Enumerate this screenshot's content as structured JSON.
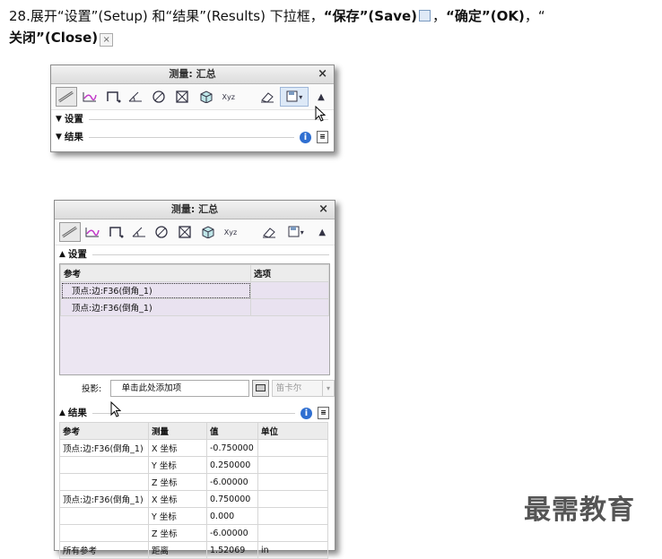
{
  "instruction": {
    "num": "28.",
    "p1": "展开“设置”(Setup) 和“结果”(Results) 下拉框，",
    "save": "“保存”(Save)",
    "sep1": "，",
    "ok": "“确定”(OK)",
    "sep2": "，“",
    "close": "关闭”(Close)",
    "close_glyph": "×"
  },
  "window": {
    "title": "测量: 汇总",
    "close_glyph": "×",
    "toolbar": {
      "icons": [
        "distance-icon",
        "length-icon",
        "diameter-icon",
        "angle-icon",
        "circle-icon",
        "area-icon",
        "volume-icon",
        "transform-icon"
      ],
      "transform_text": "Xyz",
      "eraser_icon": "eraser-icon",
      "save_icon": "save-icon",
      "dropdown": "▾",
      "collapse": "▲"
    },
    "setup_label": "设置",
    "results_label": "结果",
    "collapsed_tri": "▼",
    "expanded_tri": "▲",
    "info": "i",
    "list": "≡"
  },
  "setup": {
    "headers": [
      "参考",
      "选项"
    ],
    "refs": [
      "顶点:边:F36(倒角_1)",
      "顶点:边:F36(倒角_1)"
    ],
    "projection_label": "投影:",
    "projection_placeholder": "单击此处添加项",
    "coord_select": "笛卡尔",
    "select_arrow": "▾"
  },
  "results": {
    "headers": [
      "参考",
      "测量",
      "值",
      "单位"
    ],
    "rows": [
      [
        "顶点:边:F36(倒角_1)",
        "X 坐标",
        "-0.750000",
        ""
      ],
      [
        "",
        "Y 坐标",
        "0.250000",
        ""
      ],
      [
        "",
        "Z 坐标",
        "-6.00000",
        ""
      ],
      [
        "顶点:边:F36(倒角_1)",
        "X 坐标",
        "0.750000",
        ""
      ],
      [
        "",
        "Y 坐标",
        "0.000",
        ""
      ],
      [
        "",
        "Z 坐标",
        "-6.00000",
        ""
      ],
      [
        "所有参考",
        "距离",
        "1.52069",
        "in"
      ]
    ]
  },
  "brand": "最需教育"
}
